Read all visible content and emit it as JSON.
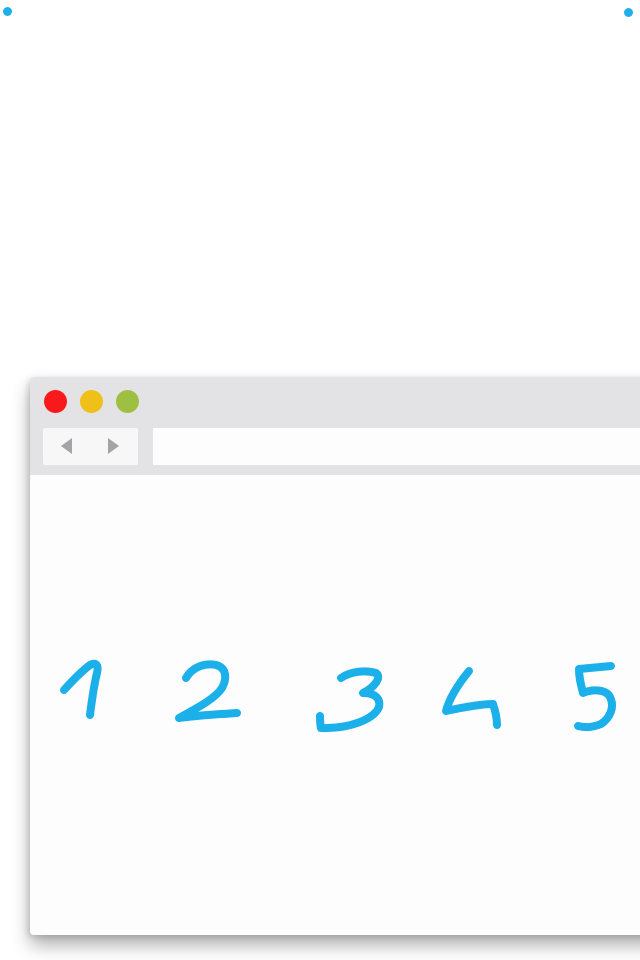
{
  "colors": {
    "accent": "#1bb0ea",
    "close": "#f8191a",
    "minimize": "#eec019",
    "zoom": "#9fbf42",
    "titlebar": "#e3e2e4",
    "nav_arrow": "#a3a3a8"
  },
  "browser": {
    "icons": {
      "close": "close-dot-icon",
      "minimize": "minimize-dot-icon",
      "zoom": "zoom-dot-icon",
      "back": "back-arrow-icon",
      "forward": "forward-arrow-icon"
    },
    "address_bar": {
      "value": "",
      "placeholder": ""
    }
  },
  "content": {
    "digits": [
      "1",
      "2",
      "3",
      "4",
      "5"
    ]
  }
}
